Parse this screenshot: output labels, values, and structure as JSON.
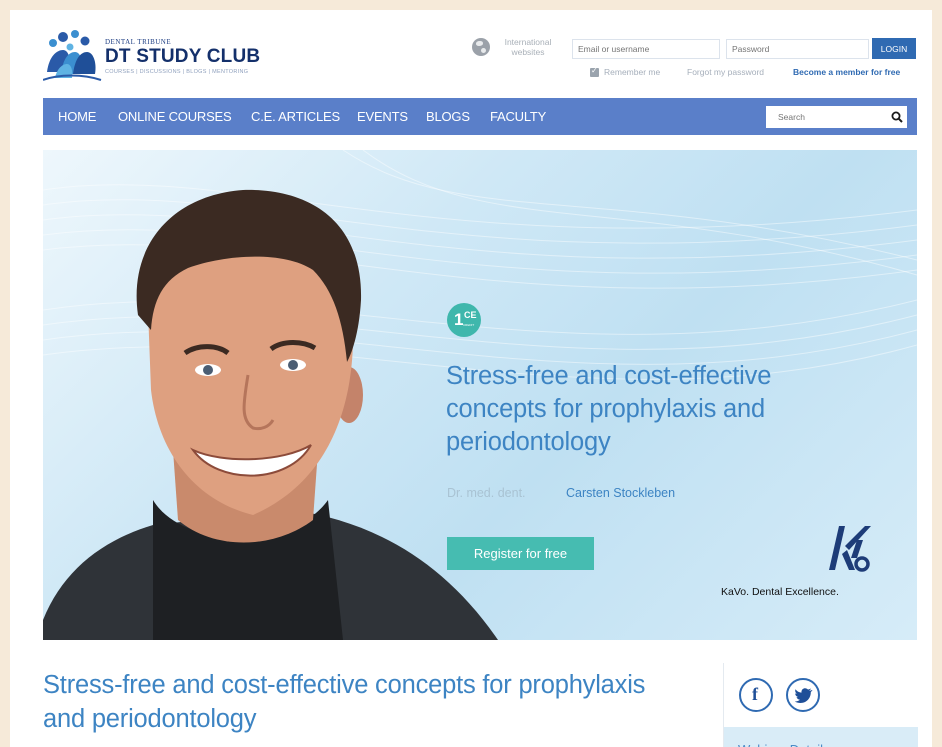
{
  "header": {
    "logo_pretitle": "DENTAL TRIBUNE",
    "logo_title": "DT STUDY CLUB",
    "logo_subtitle": "COURSES | DISCUSSIONS | BLOGS | MENTORING",
    "international_label": "International websites",
    "email_placeholder": "Email or username",
    "password_placeholder": "Password",
    "login_label": "LOGIN",
    "remember_label": "Remember me",
    "forgot_label": "Forgot my password",
    "become_member_label": "Become a member for free"
  },
  "nav": {
    "items": [
      "HOME",
      "ONLINE COURSES",
      "C.E. ARTICLES",
      "EVENTS",
      "BLOGS",
      "FACULTY"
    ],
    "search_placeholder": "Search"
  },
  "hero": {
    "ce_number": "1",
    "ce_label": "CE",
    "ce_small": "CREDIT",
    "title": "Stress-free and cost-effective concepts for prophylaxis and periodontology",
    "author_prefix": "Dr. med. dent.",
    "author_name": "Carsten Stockleben",
    "register_label": "Register for free",
    "sponsor_text": "KaVo. Dental Excellence."
  },
  "content": {
    "title": "Stress-free and cost-effective concepts for prophylaxis and periodontology"
  },
  "sidebar": {
    "webinar_label": "Webinar Details"
  },
  "colors": {
    "nav_bg": "#5a7fc9",
    "accent_blue": "#3d84c3",
    "teal": "#46bcb1",
    "login_blue": "#2f6ab2"
  }
}
